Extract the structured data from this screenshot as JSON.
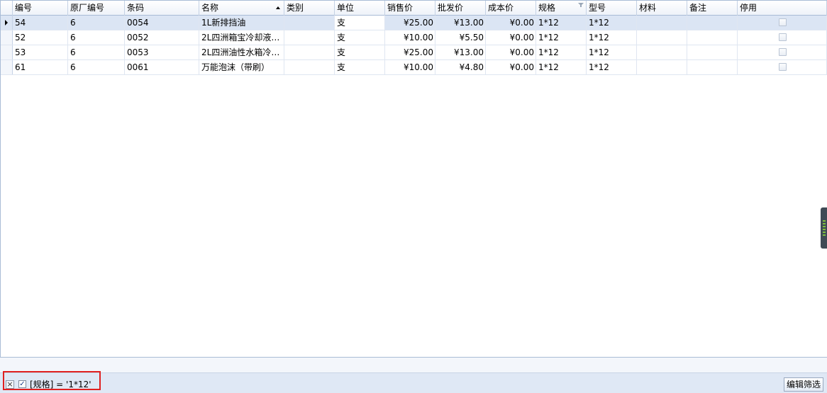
{
  "columns": [
    "编号",
    "原厂编号",
    "条码",
    "名称",
    "类别",
    "单位",
    "销售价",
    "批发价",
    "成本价",
    "规格",
    "型号",
    "材料",
    "备注",
    "停用"
  ],
  "rows": [
    {
      "id": "54",
      "factory_no": "6",
      "barcode": "0054",
      "name": "1L新排挡油",
      "category": "",
      "unit": "支",
      "sale_price": "¥25.00",
      "wholesale_price": "¥13.00",
      "cost_price": "¥0.00",
      "spec": "1*12",
      "model": "1*12",
      "material": "",
      "remark": "",
      "disabled": false
    },
    {
      "id": "52",
      "factory_no": "6",
      "barcode": "0052",
      "name": "2L四洲箱宝冷却液…",
      "category": "",
      "unit": "支",
      "sale_price": "¥10.00",
      "wholesale_price": "¥5.50",
      "cost_price": "¥0.00",
      "spec": "1*12",
      "model": "1*12",
      "material": "",
      "remark": "",
      "disabled": false
    },
    {
      "id": "53",
      "factory_no": "6",
      "barcode": "0053",
      "name": "2L四洲油性水箱冷…",
      "category": "",
      "unit": "支",
      "sale_price": "¥25.00",
      "wholesale_price": "¥13.00",
      "cost_price": "¥0.00",
      "spec": "1*12",
      "model": "1*12",
      "material": "",
      "remark": "",
      "disabled": false
    },
    {
      "id": "61",
      "factory_no": "6",
      "barcode": "0061",
      "name": "万能泡沫（带刷）",
      "category": "",
      "unit": "支",
      "sale_price": "¥10.00",
      "wholesale_price": "¥4.80",
      "cost_price": "¥0.00",
      "spec": "1*12",
      "model": "1*12",
      "material": "",
      "remark": "",
      "disabled": false
    }
  ],
  "sort": {
    "column": "名称",
    "direction": "ascending"
  },
  "filtered_column": "规格",
  "filter": {
    "enabled": true,
    "expression": "[规格] = '1*12'",
    "close_label": "×",
    "edit_label": "编辑筛选"
  },
  "colors": {
    "selected_row": "#dbe5f4",
    "header_border": "#a9bcd6",
    "highlight_box": "#e02020"
  }
}
